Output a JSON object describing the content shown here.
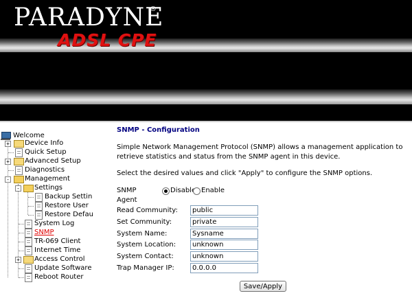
{
  "banner": {
    "brand": "PARADYNE",
    "registered_mark": "®",
    "product": "ADSL CPE"
  },
  "nav": {
    "welcome": "Welcome",
    "device_info": "Device Info",
    "quick_setup": "Quick Setup",
    "advanced_setup": "Advanced Setup",
    "diagnostics": "Diagnostics",
    "management": "Management",
    "settings": "Settings",
    "backup_settings": "Backup Settin",
    "restore_user": "Restore User",
    "restore_default": "Restore Defau",
    "system_log": "System Log",
    "snmp": "SNMP",
    "tr069_client": "TR-069 Client",
    "internet_time": "Internet Time",
    "access_control": "Access Control",
    "update_software": "Update Software",
    "reboot_router": "Reboot Router",
    "expander_plus": "+",
    "expander_minus": "-"
  },
  "page": {
    "title": "SNMP - Configuration",
    "description": "Simple Network Management Protocol (SNMP) allows a management application to retrieve statistics and status from the SNMP agent in this device.",
    "instruction": "Select the desired values and click \"Apply\" to configure the SNMP options."
  },
  "form": {
    "agent_label": "SNMP Agent",
    "agent_selected": "Disable",
    "disable_label": "Disable",
    "enable_label": "Enable",
    "read_community_label": "Read Community:",
    "read_community_value": "public",
    "set_community_label": "Set Community:",
    "set_community_value": "private",
    "system_name_label": "System Name:",
    "system_name_value": "Sysname",
    "system_location_label": "System Location:",
    "system_location_value": "unknown",
    "system_contact_label": "System Contact:",
    "system_contact_value": "unknown",
    "trap_manager_ip_label": "Trap Manager IP:",
    "trap_manager_ip_value": "0.0.0.0",
    "save_label": "Save/Apply"
  },
  "colors": {
    "banner_bg": "#000000",
    "product_red": "#e01111",
    "title_blue": "#000080",
    "active_link": "#e00000",
    "folder_yellow": "#f6d97a"
  },
  "icons": [
    "computer-icon",
    "folder-icon",
    "folder-open-icon",
    "document-icon",
    "plus-expander-icon",
    "minus-expander-icon"
  ]
}
